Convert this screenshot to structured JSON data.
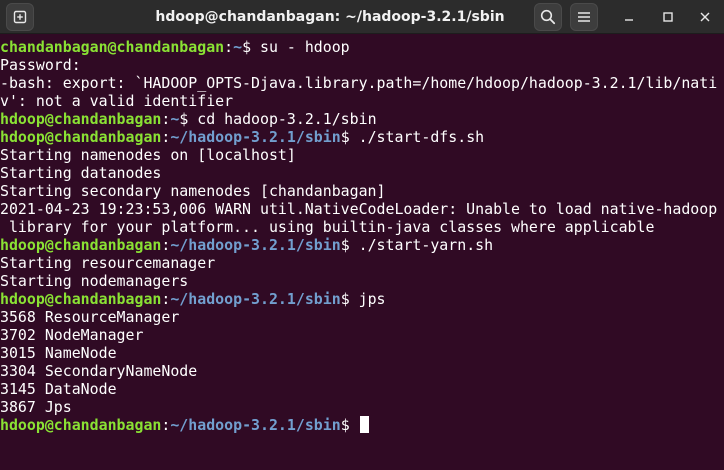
{
  "window": {
    "title": "hdoop@chandanbagan: ~/hadoop-3.2.1/sbin",
    "icons": {
      "new_tab": "new-tab-icon",
      "search": "search-icon",
      "menu": "hamburger-menu-icon",
      "minimize": "minimize-icon",
      "maximize": "maximize-icon",
      "close": "close-icon"
    }
  },
  "colors": {
    "background": "#300a24",
    "prompt_user": "#8ae234",
    "prompt_path": "#729fcf",
    "text": "#ffffff"
  },
  "terminal": {
    "lines": [
      {
        "type": "prompt",
        "user": "chandanbagan@chandanbagan",
        "path": "~",
        "cmd": "$ su - hdoop"
      },
      {
        "type": "out",
        "text": "Password:"
      },
      {
        "type": "out",
        "text": "-bash: export: `HADOOP_OPTS-Djava.library.path=/home/hdoop/hadoop-3.2.1/lib/nati"
      },
      {
        "type": "out",
        "text": "v': not a valid identifier"
      },
      {
        "type": "prompt",
        "user": "hdoop@chandanbagan",
        "path": "~",
        "cmd": "$ cd hadoop-3.2.1/sbin"
      },
      {
        "type": "prompt",
        "user": "hdoop@chandanbagan",
        "path": "~/hadoop-3.2.1/sbin",
        "cmd": "$ ./start-dfs.sh"
      },
      {
        "type": "out",
        "text": "Starting namenodes on [localhost]"
      },
      {
        "type": "out",
        "text": "Starting datanodes"
      },
      {
        "type": "out",
        "text": "Starting secondary namenodes [chandanbagan]"
      },
      {
        "type": "out",
        "text": "2021-04-23 19:23:53,006 WARN util.NativeCodeLoader: Unable to load native-hadoop"
      },
      {
        "type": "out",
        "text": " library for your platform... using builtin-java classes where applicable"
      },
      {
        "type": "prompt",
        "user": "hdoop@chandanbagan",
        "path": "~/hadoop-3.2.1/sbin",
        "cmd": "$ ./start-yarn.sh"
      },
      {
        "type": "out",
        "text": "Starting resourcemanager"
      },
      {
        "type": "out",
        "text": "Starting nodemanagers"
      },
      {
        "type": "prompt",
        "user": "hdoop@chandanbagan",
        "path": "~/hadoop-3.2.1/sbin",
        "cmd": "$ jps"
      },
      {
        "type": "out",
        "text": "3568 ResourceManager"
      },
      {
        "type": "out",
        "text": "3702 NodeManager"
      },
      {
        "type": "out",
        "text": "3015 NameNode"
      },
      {
        "type": "out",
        "text": "3304 SecondaryNameNode"
      },
      {
        "type": "out",
        "text": "3145 DataNode"
      },
      {
        "type": "out",
        "text": "3867 Jps"
      },
      {
        "type": "prompt",
        "user": "hdoop@chandanbagan",
        "path": "~/hadoop-3.2.1/sbin",
        "cmd": "$ ",
        "cursor": true
      }
    ]
  }
}
